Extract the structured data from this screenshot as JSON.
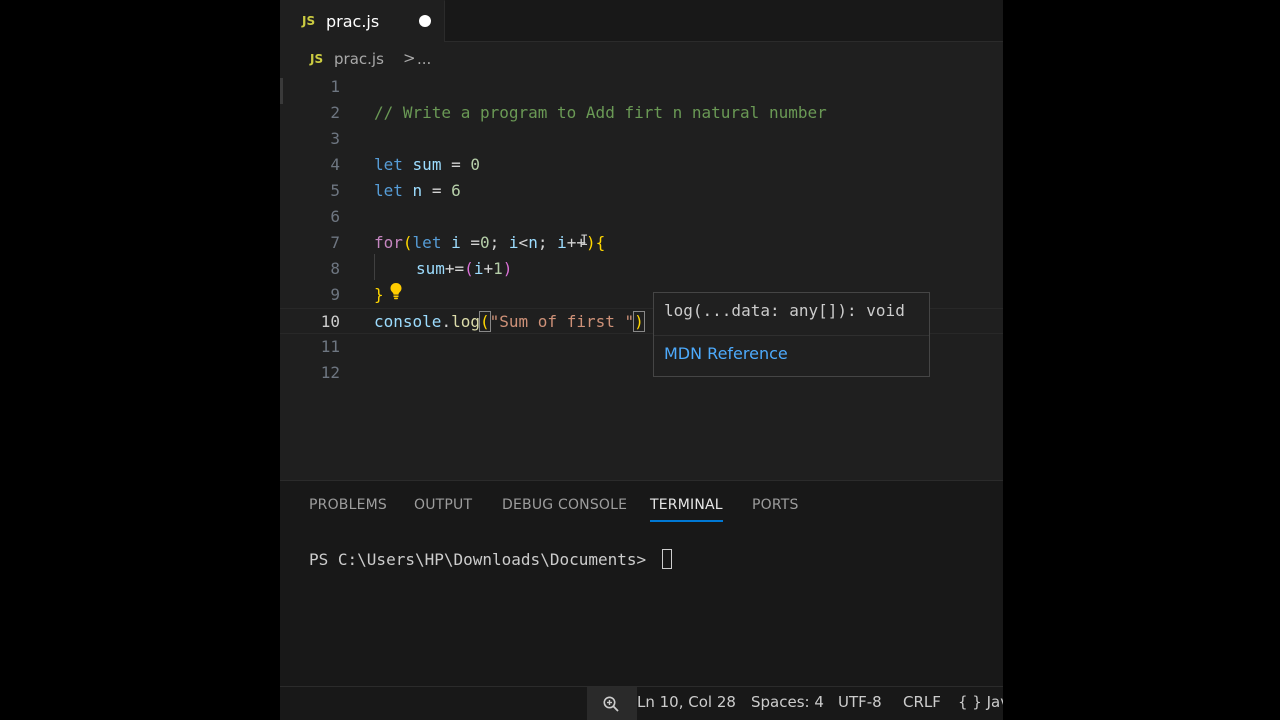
{
  "tab": {
    "icon": "JS",
    "filename": "prac.js",
    "modified_icon": "dot-icon"
  },
  "breadcrumb": {
    "icon": "JS",
    "file": "prac.js",
    "separator": ">",
    "more": "..."
  },
  "editor": {
    "lines": [
      "1",
      "2",
      "3",
      "4",
      "5",
      "6",
      "7",
      "8",
      "9",
      "10",
      "11",
      "12"
    ],
    "active_line": "10",
    "code": {
      "l2": "// Write a program to Add firt n natural number",
      "l4_kw": "let",
      "l4_var": "sum",
      "l4_op": " = ",
      "l4_num": "0",
      "l5_kw": "let",
      "l5_var": "n",
      "l5_op": " = ",
      "l5_num": "6",
      "l7_for": "for",
      "l7_open": "(",
      "l7_kw": "let",
      "l7_i": "i",
      "l7_eq": " =",
      "l7_zero": "0",
      "l7_semi1": "; ",
      "l7_i2": "i",
      "l7_lt": "<",
      "l7_n": "n",
      "l7_semi2": "; ",
      "l7_i3": "i",
      "l7_inc": "++",
      "l7_close": ")",
      "l7_brace": "{",
      "l8_sum": "sum",
      "l8_op": "+=",
      "l8_open": "(",
      "l8_i": "i",
      "l8_plus": "+",
      "l8_one": "1",
      "l8_close": ")",
      "l9_brace": "}",
      "l10_obj": "console",
      "l10_dot": ".",
      "l10_fn": "log",
      "l10_open": "(",
      "l10_str": "\"Sum of first \"",
      "l10_close": ")"
    }
  },
  "hover": {
    "signature": "log(...data: any[]): void",
    "link": "MDN Reference"
  },
  "panel": {
    "tabs": [
      "PROBLEMS",
      "OUTPUT",
      "DEBUG CONSOLE",
      "TERMINAL",
      "PORTS"
    ],
    "active_tab": "TERMINAL",
    "prompt": "PS C:\\Users\\HP\\Downloads\\Documents> "
  },
  "status": {
    "position": "Ln 10, Col 28",
    "spaces": "Spaces: 4",
    "encoding": "UTF-8",
    "eol": "CRLF",
    "language": "{ } Jav"
  },
  "colors": {
    "accent": "#0078d4",
    "js_icon": "#cbcb41",
    "link": "#4daafc"
  }
}
